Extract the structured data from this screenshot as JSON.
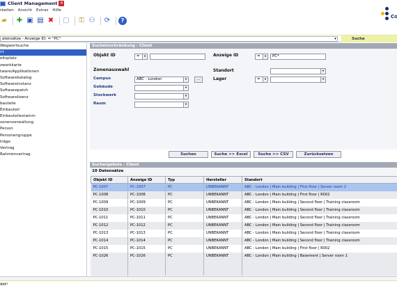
{
  "window": {
    "title": "Client Management"
  },
  "menu": [
    "rbeiten",
    "Ansicht",
    "Extras",
    "Hilfe"
  ],
  "toolbar": {
    "icons": [
      "folder-icon",
      "add-icon",
      "edit-icon",
      "save-icon",
      "delete-icon",
      "copy-icon",
      "key-icon",
      "group-icon",
      "refresh-icon",
      "help-icon"
    ]
  },
  "logo": {
    "text": "Co"
  },
  "statusline": {
    "crumb": "atensätze - Anzeige ID: = \"PC\"",
    "search_tab": "Suche"
  },
  "sidebar": {
    "items": [
      "Wegwortsuche",
      "nt",
      "eitsplatz",
      "zwerkkarte",
      "tware/Applikationen",
      "Softwarekatalog",
      "Softwareinstanz",
      "Softwarepatch",
      "Softwarelizenz",
      "bauteile",
      "Einbauteil",
      "Einbauteilestamm",
      "sonenverwaltung",
      "Person",
      "Personengruppe",
      "träge",
      "Vertrag",
      "Rahmenvertrag"
    ],
    "active_index": 1
  },
  "criteria": {
    "header": "Sucheinschränkung - Client",
    "objekt_id_label": "Objekt ID",
    "objekt_id_op": "=",
    "objekt_id_value": "",
    "anzeige_id_label": "Anzeige ID",
    "anzeige_id_op": "=",
    "anzeige_id_value": "PC*",
    "zonenauswahl_label": "Zonenauswahl",
    "standort_label": "Standort",
    "campus_label": "Campus",
    "campus_value": "ABC - London",
    "campus_browse": "...",
    "lager_label": "Lager",
    "lager_op": "=",
    "gebaeude_label": "Gebäude",
    "stockwerk_label": "Stockwerk",
    "raum_label": "Raum"
  },
  "actions": {
    "suchen": "Suchen",
    "excel": "Suche >> Excel",
    "csv": "Suche >> CSV",
    "reset": "Zurücksetzen"
  },
  "results": {
    "header": "Suchergebnis - Client",
    "count": "10 Datensätze",
    "columns": [
      "Objekt ID",
      "Anzeige ID",
      "Typ",
      "Hersteller",
      "Standort"
    ],
    "rows": [
      [
        "PC-1007",
        "PC-1007",
        "PC",
        "UNBEKANNT",
        "ABC - London | Main building | First floor | Server room 2"
      ],
      [
        "PC-1008",
        "PC-1008",
        "PC",
        "UNBEKANNT",
        "ABC - London | Main building | First floor | R002"
      ],
      [
        "PC-1009",
        "PC-1009",
        "PC",
        "UNBEKANNT",
        "ABC - London | Main building | Second floor | Training classroom"
      ],
      [
        "PC-1010",
        "PC-1010",
        "PC",
        "UNBEKANNT",
        "ABC - London | Main building | Second floor | Training classroom"
      ],
      [
        "PC-1011",
        "PC-1011",
        "PC",
        "UNBEKANNT",
        "ABC - London | Main building | Second floor | Training classroom"
      ],
      [
        "PC-1012",
        "PC-1012",
        "PC",
        "UNBEKANNT",
        "ABC - London | Main building | Second floor | Training classroom"
      ],
      [
        "PC-1013",
        "PC-1013",
        "PC",
        "UNBEKANNT",
        "ABC - London | Main building | Second floor | Training classroom"
      ],
      [
        "PC-1014",
        "PC-1014",
        "PC",
        "UNBEKANNT",
        "ABC - London | Main building | Second floor | Training classroom"
      ],
      [
        "PC-1015",
        "PC-1015",
        "PC",
        "UNBEKANNT",
        "ABC - London | Main building | First floor | R002"
      ],
      [
        "PC-1026",
        "PC-1026",
        "PC",
        "UNBEKANNT",
        "ABC - London | Main building | Basement | Server room 1"
      ]
    ],
    "selected_index": 0
  },
  "status": {
    "text": "det!"
  }
}
